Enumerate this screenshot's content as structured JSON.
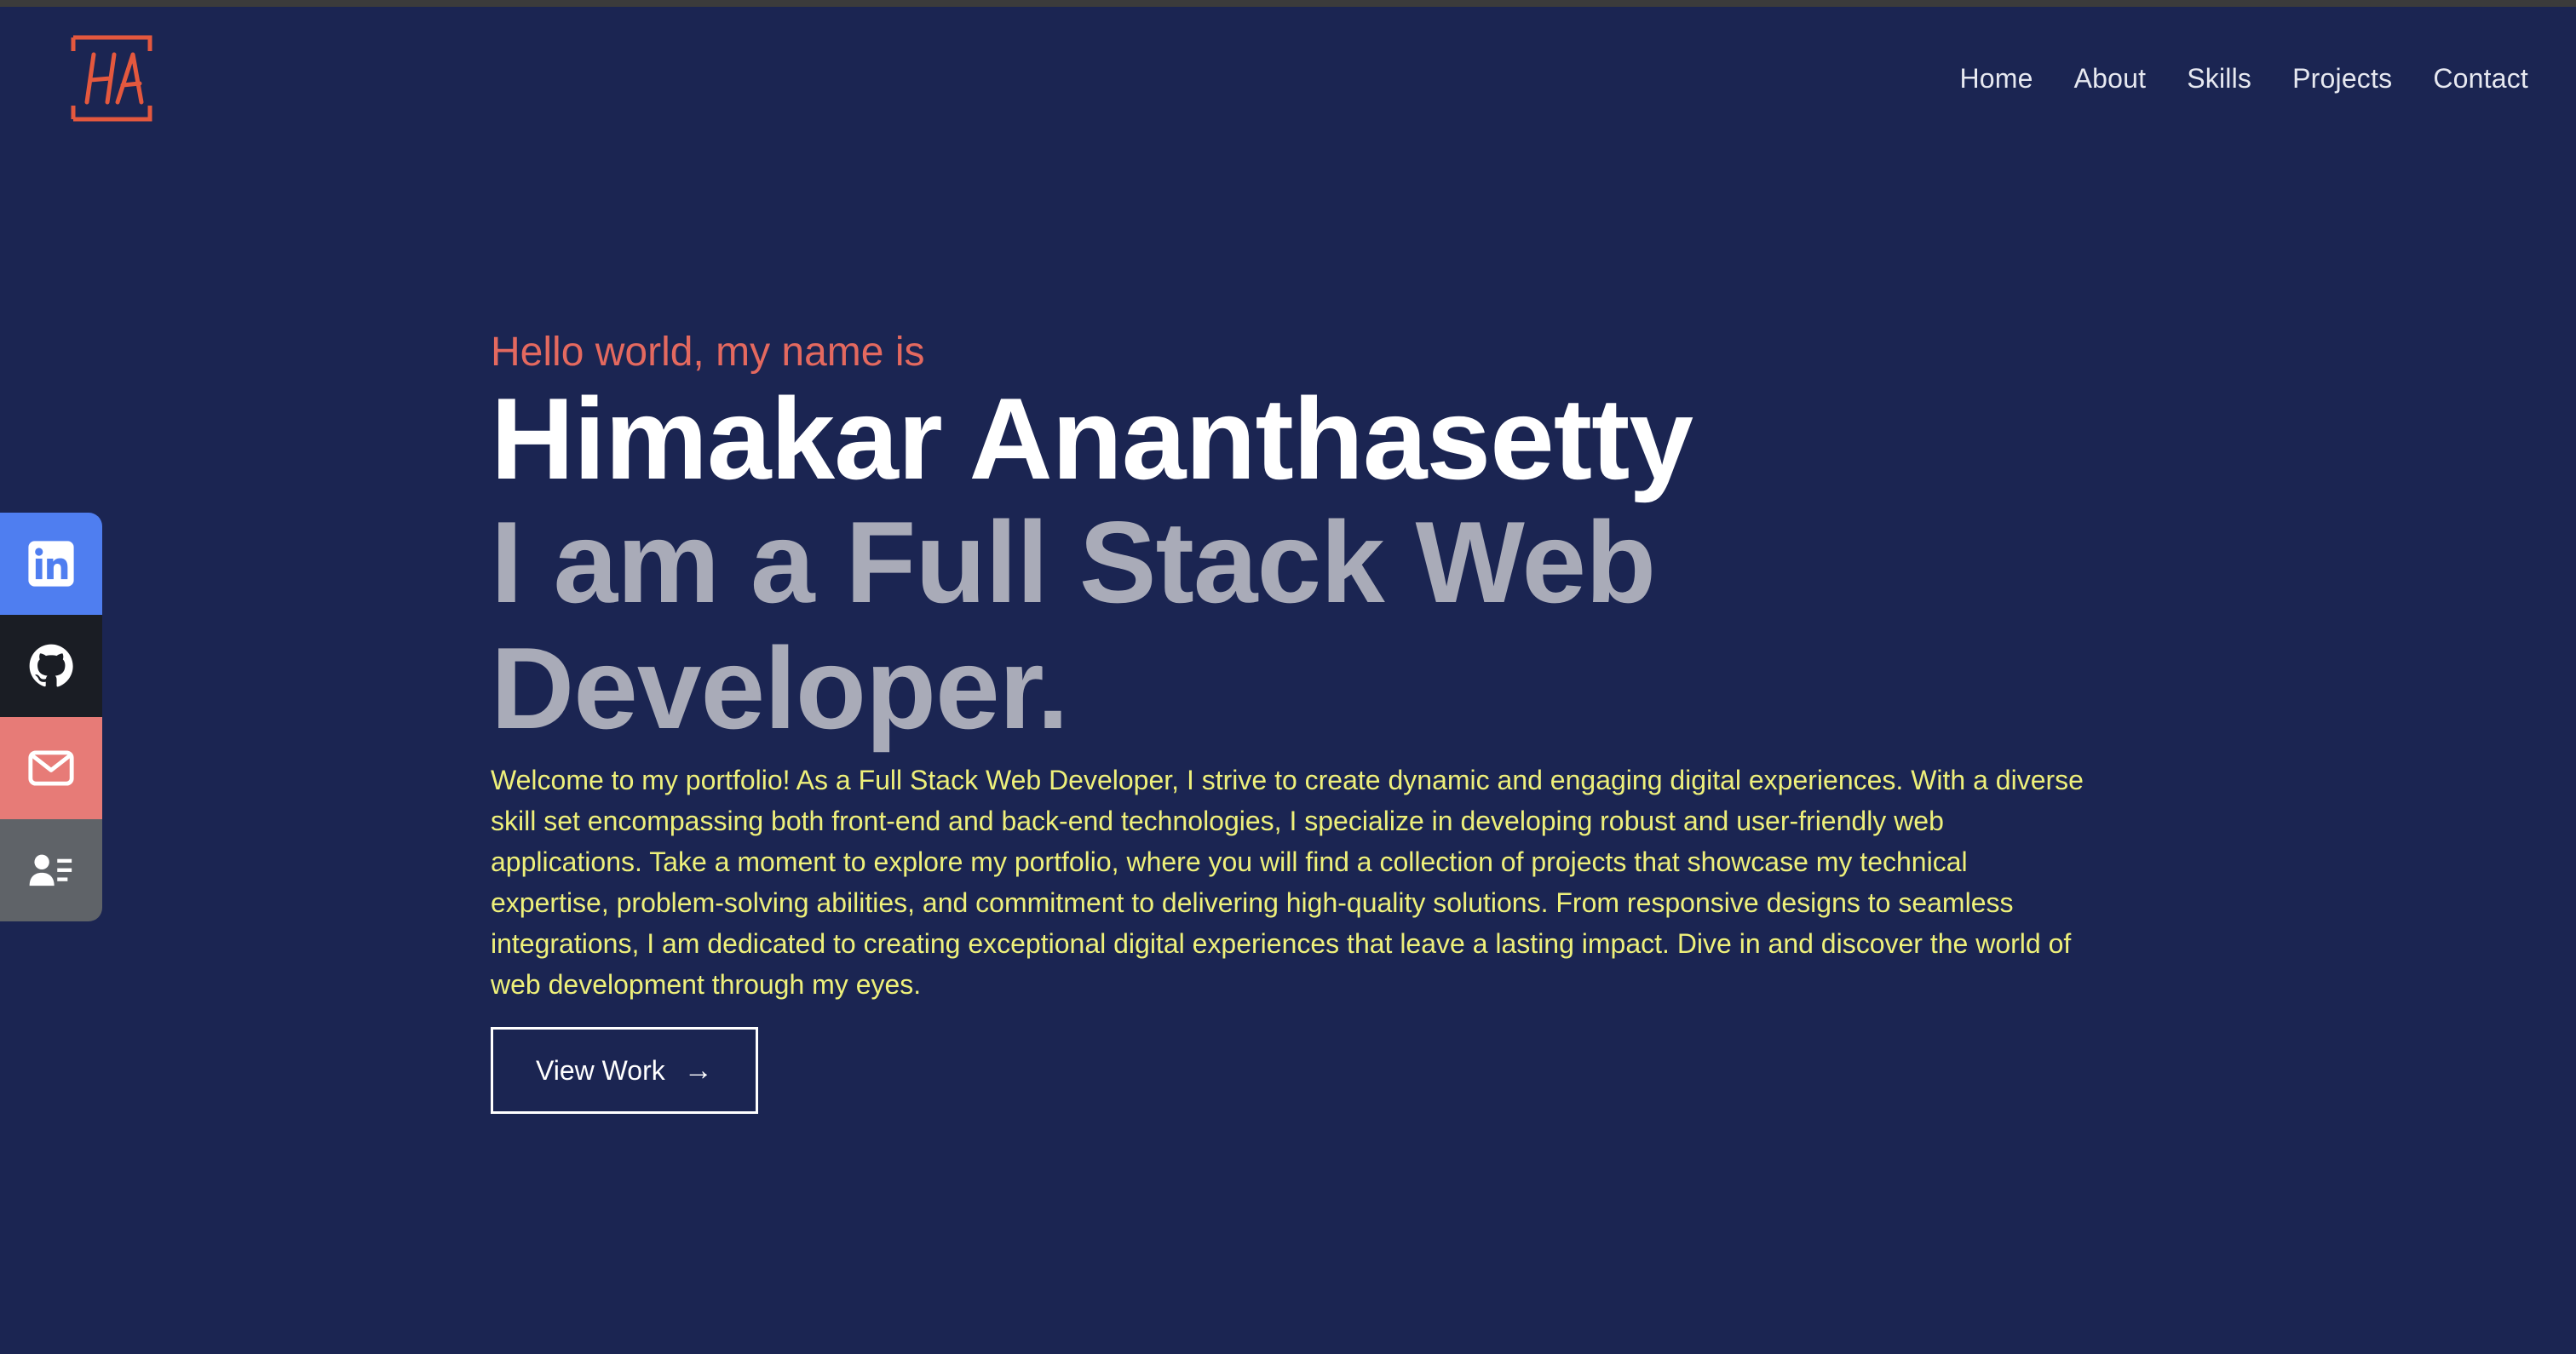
{
  "logo": {
    "text": "HA",
    "color": "#e4583e"
  },
  "nav": {
    "items": [
      {
        "label": "Home"
      },
      {
        "label": "About"
      },
      {
        "label": "Skills"
      },
      {
        "label": "Projects"
      },
      {
        "label": "Contact"
      }
    ]
  },
  "social": {
    "items": [
      {
        "name": "linkedin",
        "icon": "linkedin-icon",
        "color": "#4f7ef0"
      },
      {
        "name": "github",
        "icon": "github-icon",
        "color": "#1a1d24"
      },
      {
        "name": "email",
        "icon": "mail-icon",
        "color": "#e77b77"
      },
      {
        "name": "resume",
        "icon": "contact-card-icon",
        "color": "#5f6368"
      }
    ]
  },
  "hero": {
    "greeting": "Hello world, my name is",
    "name": "Himakar Ananthasetty",
    "role": "I am a Full Stack Web Developer.",
    "description": "Welcome to my portfolio! As a Full Stack Web Developer, I strive to create dynamic and engaging digital experiences. With a diverse skill set encompassing both front-end and back-end technologies, I specialize in developing robust and user-friendly web applications. Take a moment to explore my portfolio, where you will find a collection of projects that showcase my technical expertise, problem-solving abilities, and commitment to delivering high-quality solutions. From responsive designs to seamless integrations, I am dedicated to creating exceptional digital experiences that leave a lasting impact. Dive in and discover the world of web development through my eyes.",
    "button_label": "View Work",
    "button_icon": "arrow-right-icon"
  },
  "colors": {
    "background": "#1b2552",
    "greeting": "#e4695f",
    "name": "#ffffff",
    "role": "#a9abb8",
    "description": "#eef07a"
  }
}
